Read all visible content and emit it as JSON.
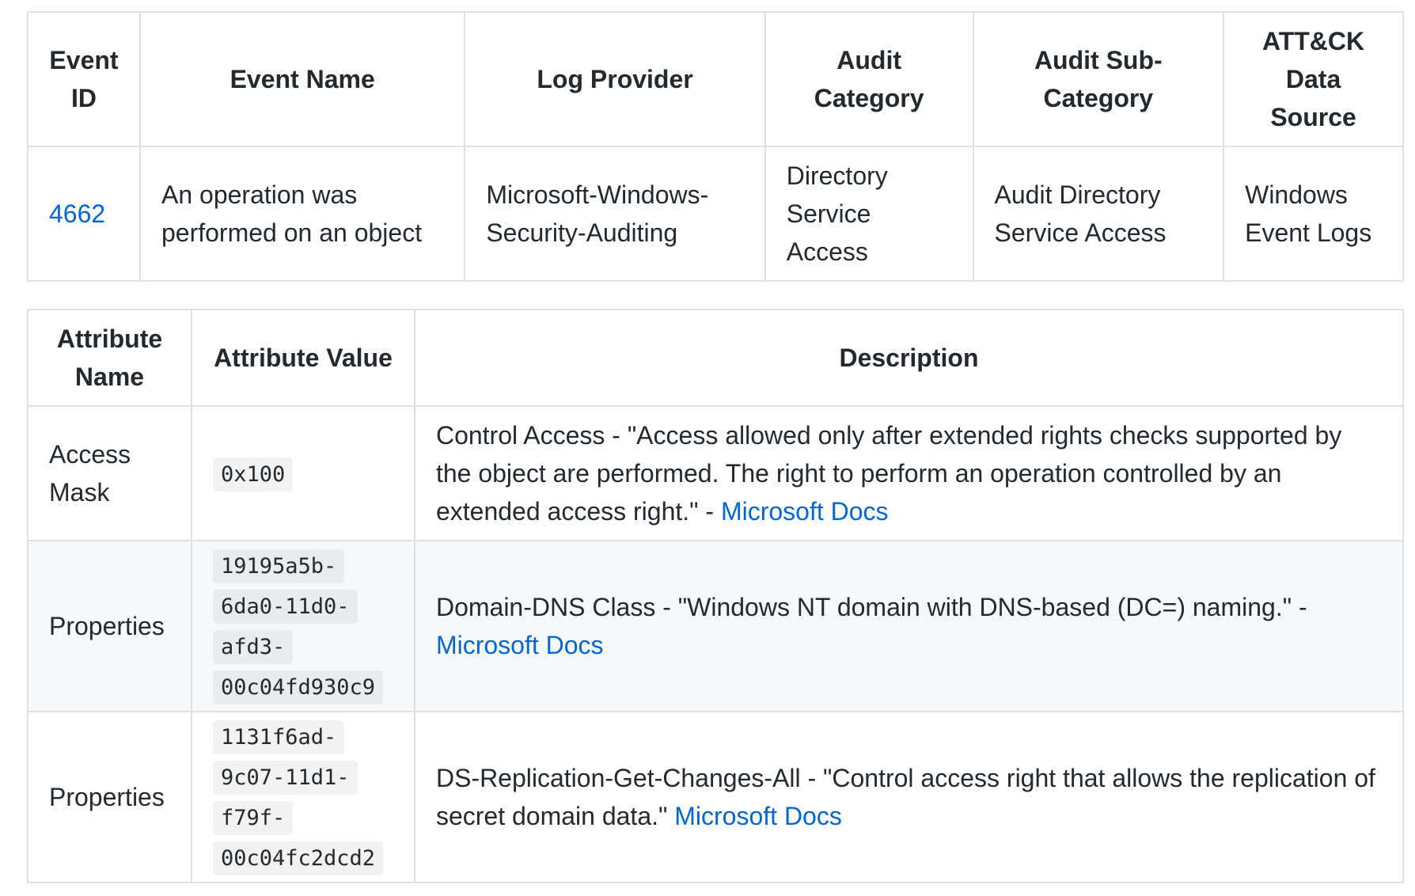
{
  "event_table": {
    "headers": {
      "event_id": "Event ID",
      "event_name": "Event Name",
      "log_provider": "Log Provider",
      "audit_category": "Audit Category",
      "audit_subcategory": "Audit Sub-Category",
      "data_source": "ATT&CK Data Source"
    },
    "row": {
      "event_id": "4662",
      "event_name": "An operation was performed on an object",
      "log_provider": "Microsoft-Windows-Security-Auditing",
      "audit_category": "Directory Service Access",
      "audit_subcategory": "Audit Directory Service Access",
      "data_source": "Windows Event Logs"
    }
  },
  "attribute_table": {
    "headers": {
      "name": "Attribute Name",
      "value": "Attribute Value",
      "description": "Description"
    },
    "rows": [
      {
        "name": "Access Mask",
        "value_lines": [
          "0x100"
        ],
        "description": "Control Access - \"Access allowed only after extended rights checks supported by the object are performed. The right to perform an operation controlled by an extended access right.\" - ",
        "link": "Microsoft Docs"
      },
      {
        "name": "Properties",
        "value_lines": [
          "19195a5b-",
          "6da0-11d0-",
          "afd3-",
          "00c04fd930c9"
        ],
        "description": "Domain-DNS Class - \"Windows NT domain with DNS-based (DC=) naming.\" - ",
        "link": "Microsoft Docs"
      },
      {
        "name": "Properties",
        "value_lines": [
          "1131f6ad-",
          "9c07-11d1-",
          "f79f-",
          "00c04fc2dcd2"
        ],
        "description": "DS-Replication-Get-Changes-All - \"Control access right that allows the replication of secret domain data.\" ",
        "link": "Microsoft Docs"
      }
    ]
  },
  "colors": {
    "link": "#0366d6",
    "border": "#dfe2e5",
    "alt_row": "#f6f8fa",
    "text": "#24292e"
  }
}
